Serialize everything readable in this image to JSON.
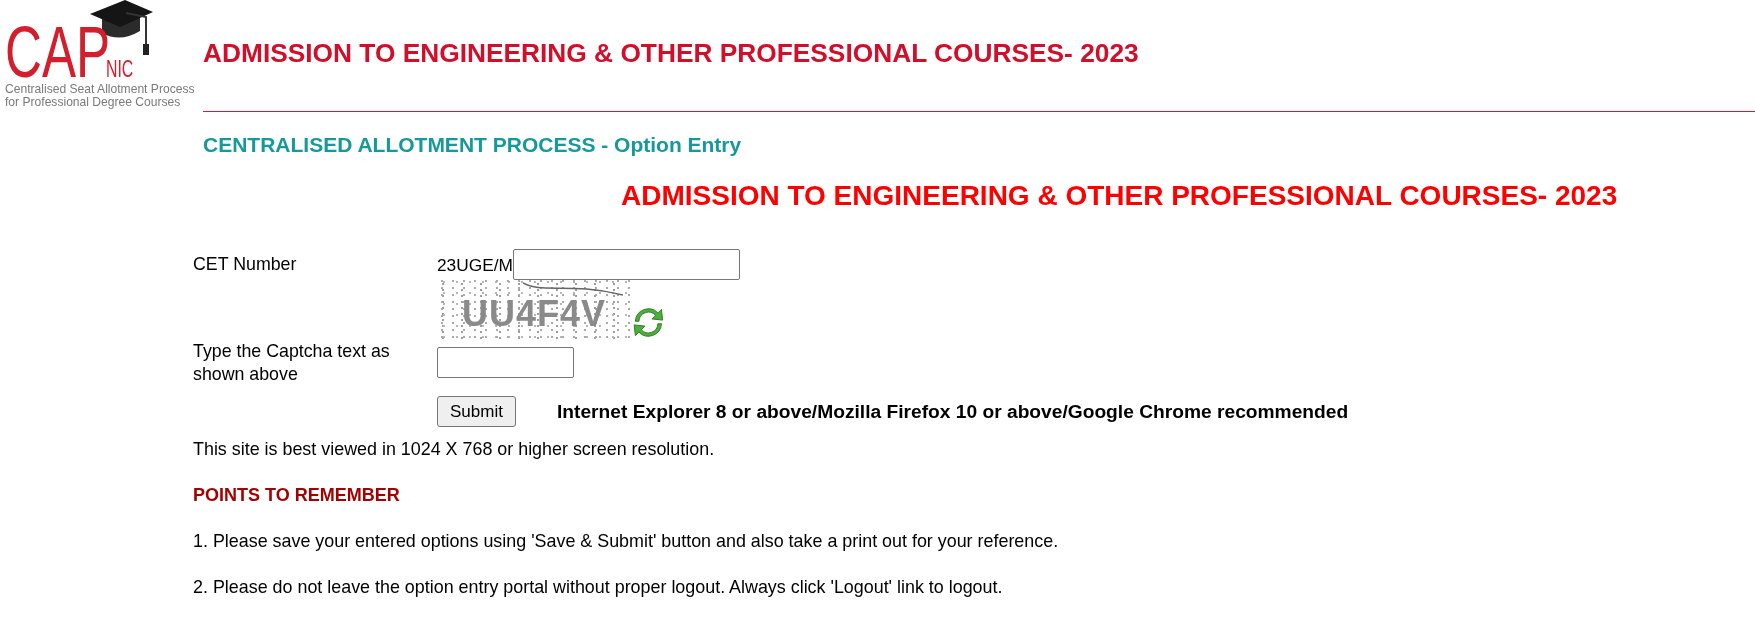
{
  "logo": {
    "wordmark": "CAP",
    "suffix": "NIC",
    "tagline_lines": [
      "Centralised Seat Allotment Process",
      "for Professional Degree Courses"
    ]
  },
  "header": {
    "title": "ADMISSION TO ENGINEERING & OTHER PROFESSIONAL COURSES- 2023"
  },
  "section_heading": "CENTRALISED ALLOTMENT PROCESS - Option Entry",
  "banner_title": "ADMISSION TO ENGINEERING & OTHER PROFESSIONAL COURSES- 2023",
  "form": {
    "cet_number": {
      "label": "CET Number",
      "prefix": "23UGE/M"
    },
    "captcha": {
      "text": "UU4F4V"
    },
    "captcha_input": {
      "label": "Type the Captcha text as shown above"
    },
    "submit": "Submit",
    "browser_note": "Internet Explorer 8 or above/Mozilla Firefox 10 or above/Google Chrome recommended"
  },
  "resolution_note": "This site is best viewed in 1024 X 768 or higher screen resolution.",
  "points": {
    "title": "POINTS TO REMEMBER",
    "items": [
      "1. Please save your entered options using 'Save & Submit' button and also take a print out for your reference.",
      "2. Please do not leave the option entry portal without proper logout. Always click 'Logout' link to logout."
    ]
  }
}
